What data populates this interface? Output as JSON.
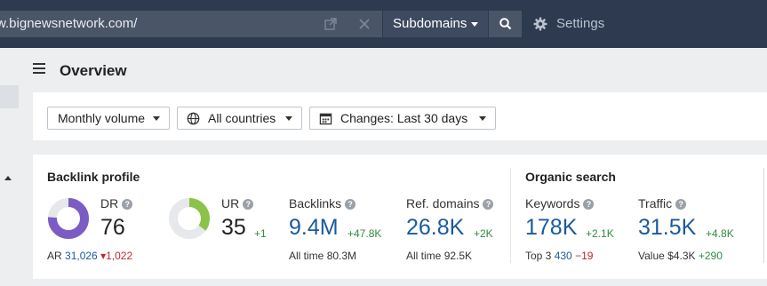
{
  "topbar": {
    "url": "w.bignewsnetwork.com/",
    "mode_label": "Subdomains",
    "settings_label": "Settings"
  },
  "page": {
    "title": "Overview"
  },
  "filters": {
    "volume": "Monthly volume",
    "country": "All countries",
    "changes": "Changes: Last 30 days"
  },
  "backlink_profile": {
    "title": "Backlink profile",
    "dr": {
      "label": "DR",
      "value": "76",
      "fraction": 0.76
    },
    "ar": {
      "label": "AR",
      "value": "31,026",
      "change": "1,022"
    },
    "ur": {
      "label": "UR",
      "value": "35",
      "change": "+1",
      "fraction": 0.35
    },
    "backlinks": {
      "label": "Backlinks",
      "value": "9.4M",
      "change": "+47.8K",
      "sub_label": "All time",
      "sub_value": "80.3M"
    },
    "ref_domains": {
      "label": "Ref. domains",
      "value": "26.8K",
      "change": "+2K",
      "sub_label": "All time",
      "sub_value": "92.5K"
    }
  },
  "organic_search": {
    "title": "Organic search",
    "keywords": {
      "label": "Keywords",
      "value": "178K",
      "change": "+2.1K",
      "sub_label": "Top 3",
      "sub_value": "430",
      "sub_change": "−19"
    },
    "traffic": {
      "label": "Traffic",
      "value": "31.5K",
      "change": "+4.8K",
      "sub_label": "Value",
      "sub_value": "$4.3K",
      "sub_change": "+290"
    }
  },
  "colors": {
    "dr_ring": "#7b5cc4",
    "ur_ring": "#8bc34a",
    "ring_track": "#e6e8eb",
    "link_blue": "#1b5a9c",
    "positive": "#2e8b3e",
    "negative": "#c0272d"
  },
  "icons": [
    "external-link-icon",
    "clear-icon",
    "search-icon",
    "gear-icon",
    "hamburger-icon",
    "globe-icon",
    "calendar-icon",
    "help-icon"
  ]
}
